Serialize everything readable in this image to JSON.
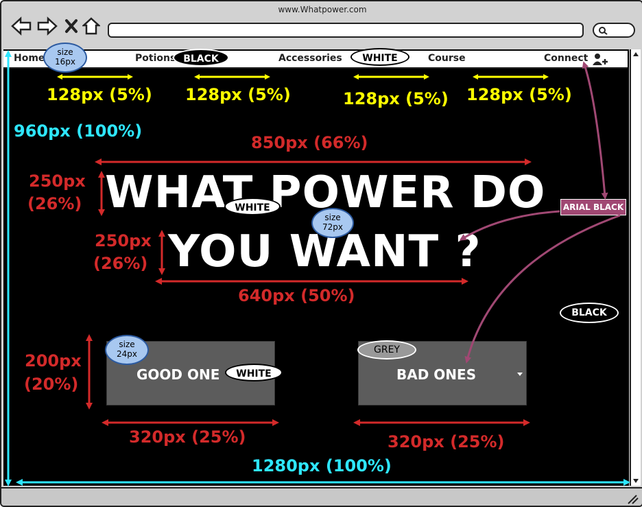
{
  "browser": {
    "url": "www.Whatpower.com"
  },
  "nav": {
    "home": "Home",
    "potions": "Potions",
    "accessories": "Accessories",
    "course": "Course",
    "connect": "Connect"
  },
  "hero": {
    "line1": "WHAT POWER DO",
    "line2": "YOU WANT ?"
  },
  "buttons": {
    "good": "GOOD ONE",
    "bad": "BAD ONES"
  },
  "tags": {
    "black_nav": "BLACK",
    "white_nav": "WHITE",
    "white_hero": "WHITE",
    "white_button": "WHITE",
    "grey_button": "GREY",
    "black_bg": "BLACK",
    "arial_black": "ARIAL BLACK"
  },
  "size_bubbles": {
    "nav": {
      "label": "size",
      "value": "16px"
    },
    "hero": {
      "label": "size",
      "value": "72px"
    },
    "button": {
      "label": "size",
      "value": "24px"
    }
  },
  "annotations": {
    "spacing_1": "128px (5%)",
    "spacing_2": "128px (5%)",
    "spacing_3": "128px (5%)",
    "spacing_4": "128px (5%)",
    "height_960": "960px (100%)",
    "hero_width": "850px (66%)",
    "hero_h1_a": "250px",
    "hero_h1_b": "(26%)",
    "hero_h2_a": "250px",
    "hero_h2_b": "(26%)",
    "line2_width": "640px (50%)",
    "button_h_a": "200px",
    "button_h_b": "(20%)",
    "button_w1": "320px (25%)",
    "button_w2": "320px (25%)",
    "width_1280": "1280px (100%)"
  },
  "colors": {
    "yellow": "#ffff00",
    "red": "#d32a2a",
    "cyan": "#2ee6ff",
    "purple": "#a04873",
    "button_grey": "#5c5c5c"
  }
}
